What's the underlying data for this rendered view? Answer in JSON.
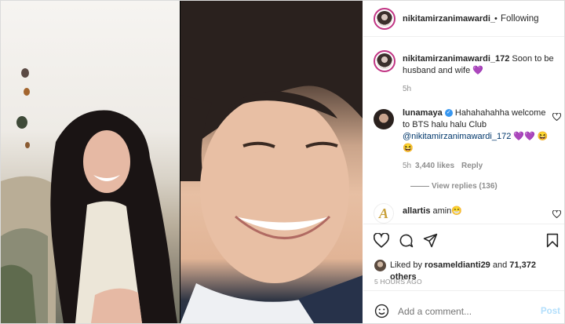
{
  "header": {
    "username": "nikitamirzanimawardi_",
    "separator": "•",
    "follow_label": "Following"
  },
  "caption": {
    "username": "nikitamirzanimawardi_172",
    "text": "Soon to be husband and wife",
    "emoji": "💜",
    "time": "5h"
  },
  "comments": [
    {
      "username": "lunamaya",
      "text": "Hahahahahha welcome to BTS halu halu Club",
      "mention": "@nikitamirzanimawardi_172",
      "emoji": "💜💜",
      "emoji2": "😆😆",
      "time": "5h",
      "likes": "3,440 likes",
      "reply_label": "Reply",
      "view_replies": "View replies (136)"
    },
    {
      "username": "allartis",
      "text": "amin😁"
    }
  ],
  "actions": {
    "liked_by_prefix": "Liked by",
    "liked_by_user": "rosameldianti29",
    "liked_by_mid": "and",
    "liked_by_count": "71,372 others",
    "timestamp": "5 HOURS AGO"
  },
  "composer": {
    "placeholder": "Add a comment...",
    "post_label": "Post"
  },
  "colors": {
    "link": "#00376b",
    "post_button": "#b2dffc",
    "verified": "#3897f0"
  }
}
